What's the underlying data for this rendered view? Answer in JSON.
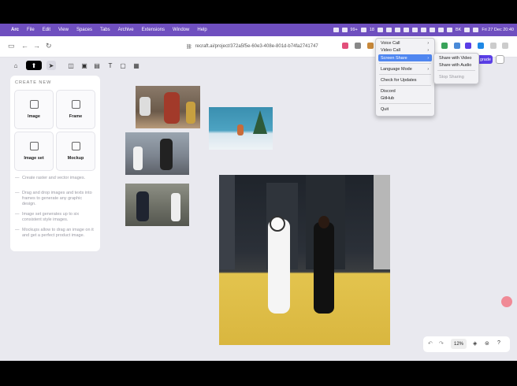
{
  "menubar": {
    "items": [
      "Arc",
      "File",
      "Edit",
      "View",
      "Spaces",
      "Tabs",
      "Archive",
      "Extensions",
      "Window",
      "Help"
    ],
    "status_badge_1": "99+",
    "status_badge_2": "18",
    "battery": "BK",
    "datetime": "Fri 27 Dec  20:40"
  },
  "browser": {
    "url": "recraft.ai/project/372a5f5e-60e3-408e-801d-b74fa2741747"
  },
  "app": {
    "upgrade_label": "grade"
  },
  "create_panel": {
    "title": "CREATE NEW",
    "cards": [
      "Image",
      "Frame",
      "Image set",
      "Mockup"
    ],
    "tips": [
      "Create raster and vector images.",
      "Drag and drop images and texts into frames to generate any graphic design.",
      "Image set generates up to six consistent style images.",
      "Mockups allow to drag an image on it and get a perfect product image."
    ]
  },
  "zoom": {
    "value": "12%"
  },
  "context_menu": {
    "items": [
      {
        "label": "Voice Call",
        "submenu": true
      },
      {
        "label": "Video Call",
        "submenu": true
      },
      {
        "label": "Screen Share",
        "submenu": true,
        "highlighted": true
      },
      {
        "label": "Language Mode",
        "submenu": true
      },
      {
        "label": "Check for Updates"
      },
      {
        "label": "Discord"
      },
      {
        "label": "GitHub"
      },
      {
        "label": "Quit"
      }
    ],
    "submenu": [
      "Share with Video",
      "Share with Audio",
      "Stop Sharing"
    ]
  },
  "colors": {
    "menubar": "#6f4fbf",
    "accent": "#5a3ee6",
    "highlight": "#4f86f0"
  }
}
